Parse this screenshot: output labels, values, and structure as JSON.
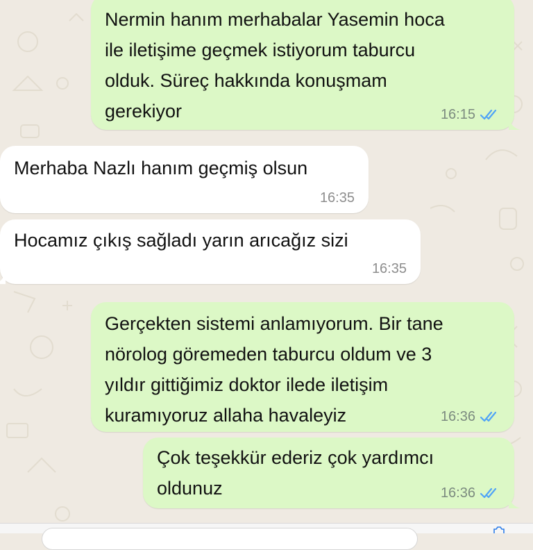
{
  "chat": {
    "messages": [
      {
        "direction": "outgoing",
        "text": "Nermin hanım merhabalar Yasemin hoca\nile iletişime geçmek istiyorum taburcu\nolduk. Süreç hakkında konuşmam\ngerekiyor",
        "time": "16:15",
        "status": "read"
      },
      {
        "direction": "incoming",
        "text": "Merhaba Nazlı hanım geçmiş olsun",
        "time": "16:35"
      },
      {
        "direction": "incoming",
        "text": "Hocamız çıkış sağladı yarın arıcağız sizi",
        "time": "16:35"
      },
      {
        "direction": "outgoing",
        "text": "Gerçekten sistemi anlamıyorum. Bir tane\nnörolog göremeden taburcu oldum ve 3\nyıldır gittiğimiz doktor ilede iletişim\nkuramıyoruz allaha havaleyiz",
        "time": "16:36",
        "status": "read"
      },
      {
        "direction": "outgoing",
        "text": "Çok teşekkür ederiz çok yardımcı\noldunuz",
        "time": "16:36",
        "status": "read"
      }
    ]
  },
  "colors": {
    "wallpaper": "#efeae2",
    "outgoing_bubble": "#dcf8c6",
    "incoming_bubble": "#ffffff",
    "read_ticks": "#4fa3f7"
  },
  "icons": {
    "read_receipt": "double-check-icon",
    "camera": "camera-icon"
  }
}
